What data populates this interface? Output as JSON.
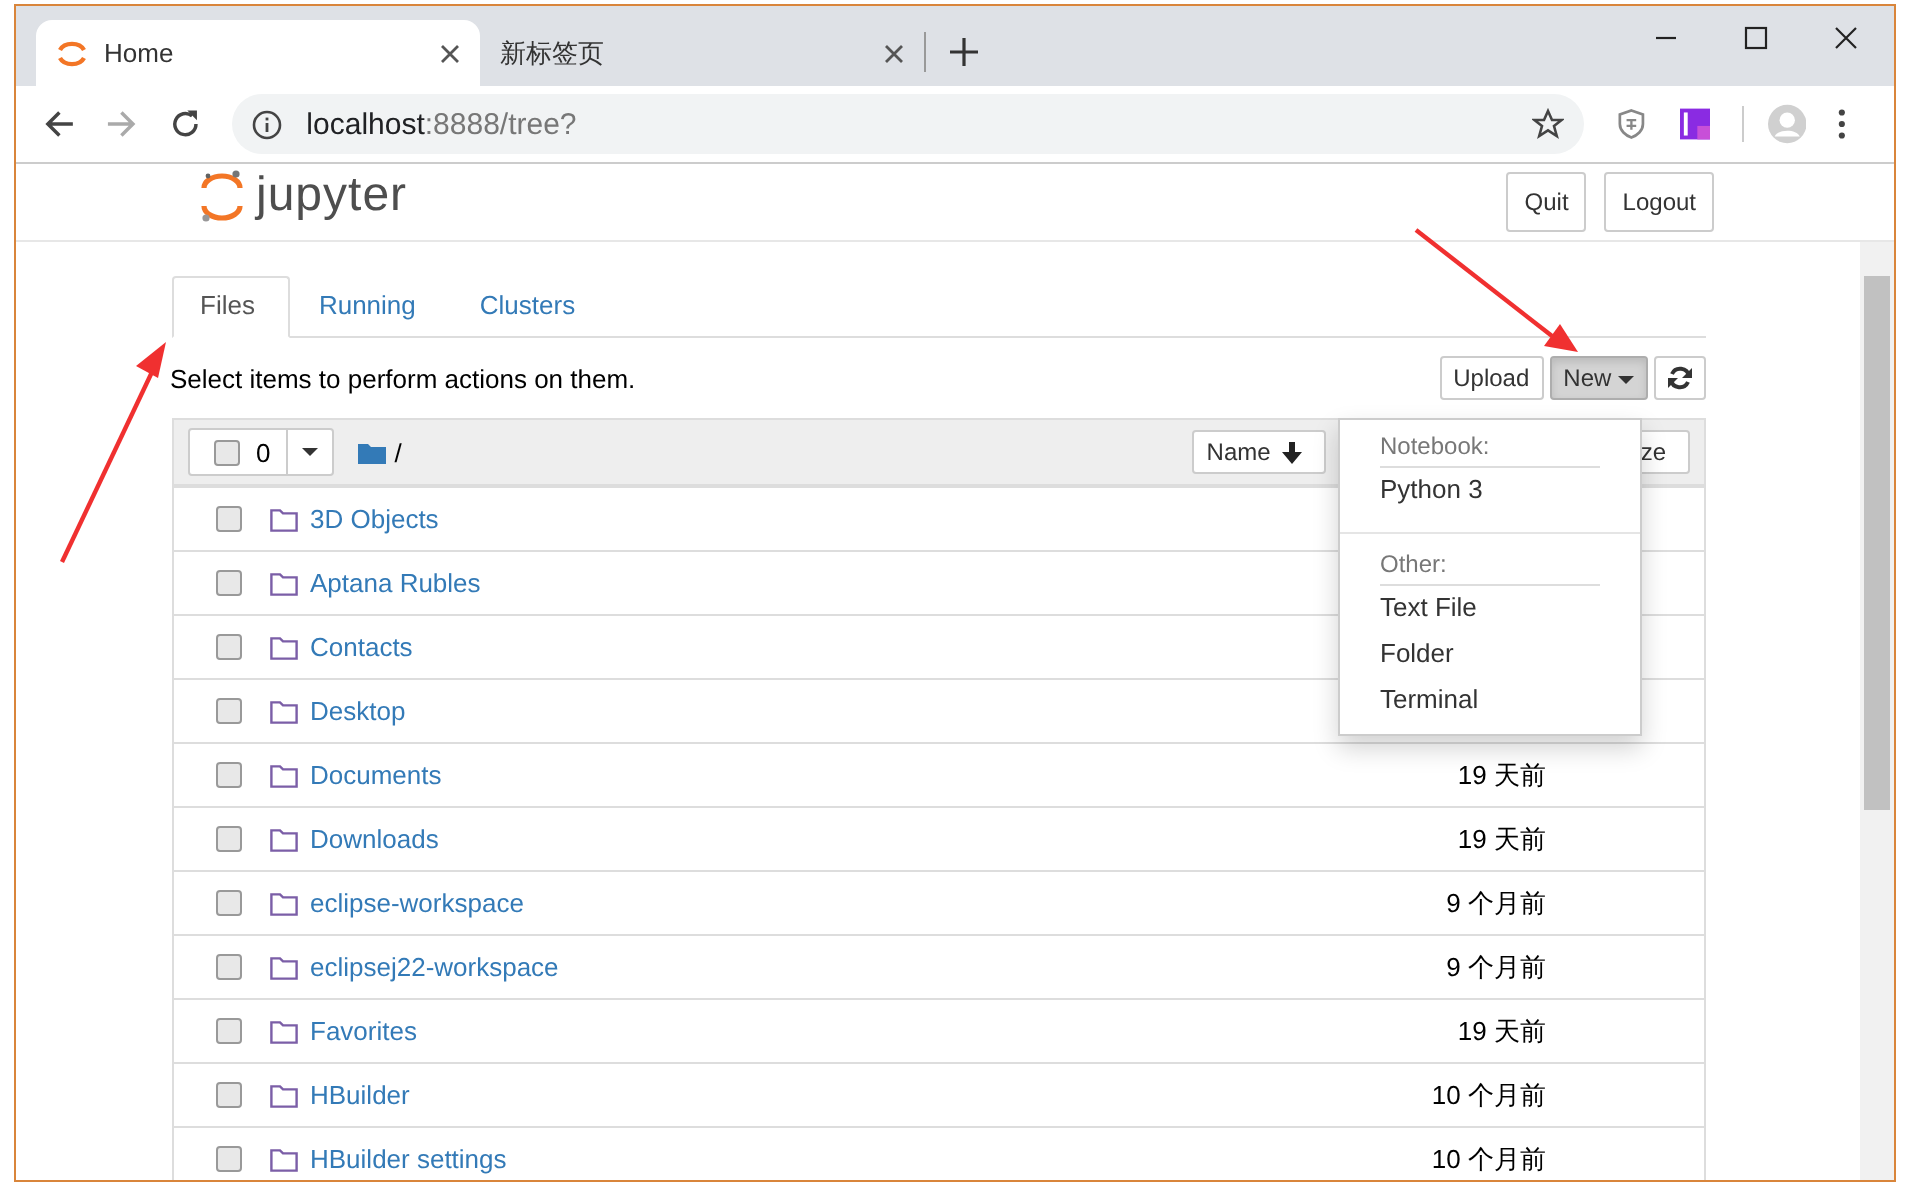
{
  "browser": {
    "tabs": [
      {
        "title": "Home",
        "selected": true
      },
      {
        "title": "新标签页",
        "selected": false
      }
    ],
    "address": {
      "host": "localhost",
      "rest": ":8888/tree?"
    }
  },
  "header": {
    "logo": "jupyter",
    "buttons": [
      "Quit",
      "Logout"
    ]
  },
  "tabs": [
    {
      "label": "Files",
      "selected": true
    },
    {
      "label": "Running",
      "selected": false
    },
    {
      "label": "Clusters",
      "selected": false
    }
  ],
  "toolbar": {
    "hint": "Select items to perform actions on them.",
    "buttons": [
      {
        "kind": "text",
        "label": "Upload",
        "open": false
      },
      {
        "kind": "dropdown",
        "label": "New",
        "open": true
      },
      {
        "kind": "refresh",
        "open": false
      }
    ]
  },
  "list_header": {
    "selected_count": "0",
    "path": "/",
    "sort_buttons": [
      {
        "label": "Name",
        "sorted": true
      },
      {
        "label": "ze",
        "sorted": false
      }
    ]
  },
  "menu": {
    "sections": [
      {
        "heading": "Notebook:",
        "items": [
          "Python 3"
        ]
      },
      {
        "heading": "Other:",
        "items": [
          "Text File",
          "Folder",
          "Terminal"
        ]
      }
    ]
  },
  "rows": [
    {
      "name": "3D Objects",
      "checked": false
    },
    {
      "name": "Aptana Rubles",
      "checked": false
    },
    {
      "name": "Contacts",
      "checked": false
    },
    {
      "name": "Desktop",
      "checked": false
    },
    {
      "name": "Documents",
      "checked": false,
      "modified": "19 天前"
    },
    {
      "name": "Downloads",
      "checked": false,
      "modified": "19 天前"
    },
    {
      "name": "eclipse-workspace",
      "checked": false,
      "modified": "9 个月前"
    },
    {
      "name": "eclipsej22-workspace",
      "checked": false,
      "modified": "9 个月前"
    },
    {
      "name": "Favorites",
      "checked": false,
      "modified": "19 天前"
    },
    {
      "name": "HBuilder",
      "checked": false,
      "modified": "10 个月前"
    },
    {
      "name": "HBuilder settings",
      "checked": false,
      "modified": "10 个月前"
    }
  ]
}
